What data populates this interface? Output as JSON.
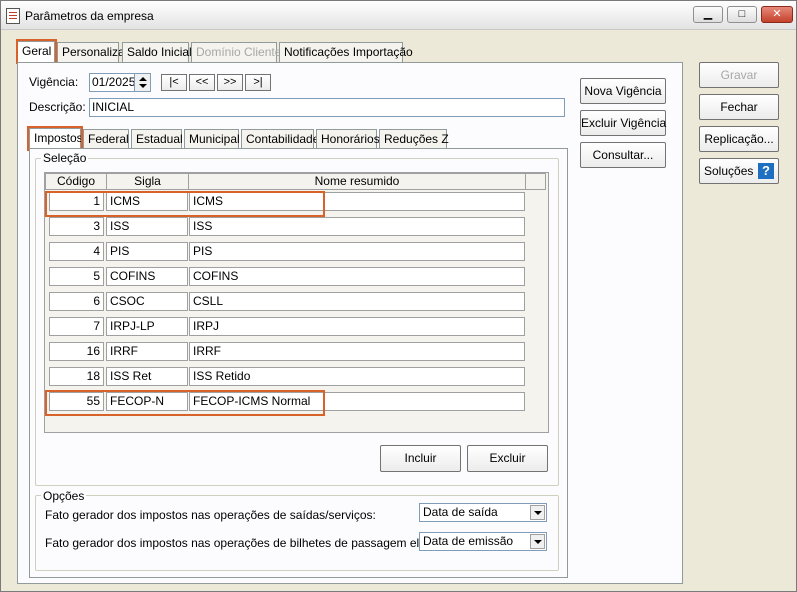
{
  "window": {
    "title": "Parâmetros da empresa",
    "min": "▁",
    "max": "□",
    "close": "✕"
  },
  "main_tabs": [
    "Geral",
    "Personaliza",
    "Saldo Inicial",
    "Domínio Cliente",
    "Notificações Importação"
  ],
  "vigencia": {
    "label": "Vigência:",
    "value": "01/2025",
    "nav": [
      "|<",
      "<<",
      ">>",
      ">|"
    ]
  },
  "descricao": {
    "label": "Descrição:",
    "value": "INICIAL"
  },
  "middle_buttons": [
    "Nova Vigência",
    "Excluir Vigência",
    "Consultar..."
  ],
  "right_buttons": [
    "Gravar",
    "Fechar",
    "Replicação...",
    "Soluções"
  ],
  "help_glyph": "?",
  "sub_tabs": [
    "Impostos",
    "Federal",
    "Estadual",
    "Municipal",
    "Contabilidade",
    "Honorários",
    "Reduções Z"
  ],
  "selecao": {
    "title": "Seleção",
    "headers": [
      "Código",
      "Sigla",
      "Nome resumido"
    ],
    "rows": [
      {
        "codigo": "1",
        "sigla": "ICMS",
        "nome": "ICMS"
      },
      {
        "codigo": "3",
        "sigla": "ISS",
        "nome": "ISS"
      },
      {
        "codigo": "4",
        "sigla": "PIS",
        "nome": "PIS"
      },
      {
        "codigo": "5",
        "sigla": "COFINS",
        "nome": "COFINS"
      },
      {
        "codigo": "6",
        "sigla": "CSOC",
        "nome": "CSLL"
      },
      {
        "codigo": "7",
        "sigla": "IRPJ-LP",
        "nome": "IRPJ"
      },
      {
        "codigo": "16",
        "sigla": "IRRF",
        "nome": "IRRF"
      },
      {
        "codigo": "18",
        "sigla": "ISS Ret",
        "nome": "ISS Retido"
      },
      {
        "codigo": "55",
        "sigla": "FECOP-N",
        "nome": "FECOP-ICMS Normal"
      }
    ],
    "incluir": "Incluir",
    "excluir": "Excluir"
  },
  "opcoes": {
    "title": "Opções",
    "fato_saidas_label": "Fato gerador dos impostos nas operações de saídas/serviços:",
    "fato_saidas_value": "Data de saída",
    "fato_bilhetes_label": "Fato gerador dos impostos nas operações de bilhetes de passagem eletrônico:",
    "fato_bilhetes_value": "Data de emissão"
  },
  "colors": {
    "highlight": "#d9622b",
    "window_bg": "#ece9d8",
    "panel_bg": "#fcfcfe"
  }
}
